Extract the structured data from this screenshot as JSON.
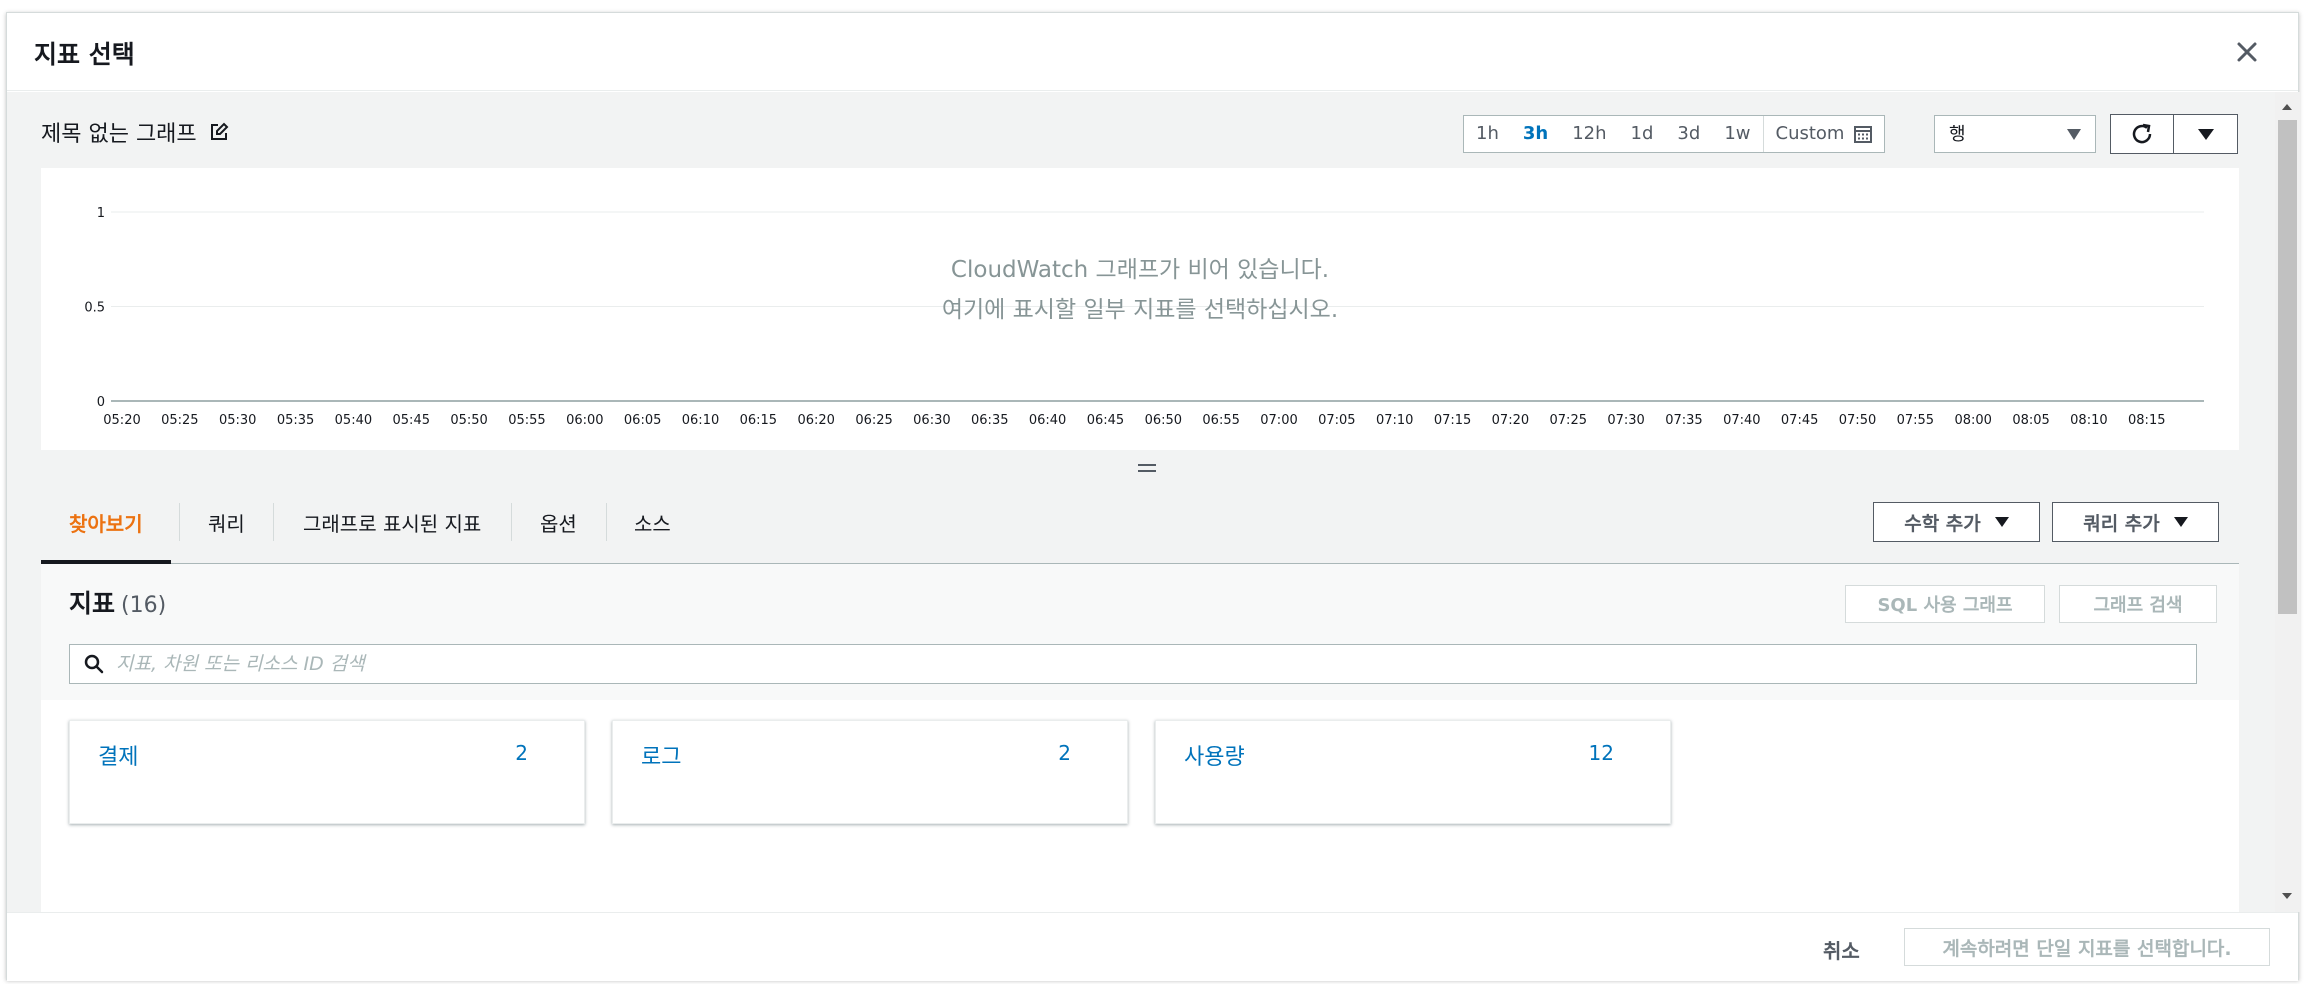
{
  "modal": {
    "title": "지표 선택",
    "close_icon": "close-icon"
  },
  "graph": {
    "title": "제목 없는 그래프",
    "edit_icon": "edit-icon",
    "time_ranges": [
      "1h",
      "3h",
      "12h",
      "1d",
      "3d",
      "1w"
    ],
    "active_range": "3h",
    "custom_label": "Custom",
    "custom_icon": "calendar-icon",
    "view_select_value": "행",
    "refresh_icon": "refresh-icon",
    "empty_line1": "CloudWatch 그래프가 비어 있습니다.",
    "empty_line2": "여기에 표시할 일부 지표를 선택하십시오."
  },
  "chart_data": {
    "type": "line",
    "x": [
      "05:20",
      "05:25",
      "05:30",
      "05:35",
      "05:40",
      "05:45",
      "05:50",
      "05:55",
      "06:00",
      "06:05",
      "06:10",
      "06:15",
      "06:20",
      "06:25",
      "06:30",
      "06:35",
      "06:40",
      "06:45",
      "06:50",
      "06:55",
      "07:00",
      "07:05",
      "07:10",
      "07:15",
      "07:20",
      "07:25",
      "07:30",
      "07:35",
      "07:40",
      "07:45",
      "07:50",
      "07:55",
      "08:00",
      "08:05",
      "08:10",
      "08:15"
    ],
    "y_ticks": [
      "1",
      "0.5",
      "0"
    ],
    "ylim": [
      0,
      1
    ],
    "series": [],
    "grid": true
  },
  "tabs": [
    {
      "label": "찾아보기",
      "active": true
    },
    {
      "label": "쿼리",
      "active": false
    },
    {
      "label": "그래프로 표시된 지표",
      "active": false
    },
    {
      "label": "옵션",
      "active": false
    },
    {
      "label": "소스",
      "active": false
    }
  ],
  "actions": {
    "add_math": "수학 추가",
    "add_query": "쿼리 추가"
  },
  "metrics": {
    "title": "지표",
    "count": "(16)",
    "sql_graph": "SQL 사용 그래프",
    "graph_search": "그래프 검색",
    "search_placeholder": "지표, 차원 또는 리소스 ID 검색",
    "search_icon": "search-icon",
    "namespaces": [
      {
        "name": "결제",
        "count": "2"
      },
      {
        "name": "로그",
        "count": "2"
      },
      {
        "name": "사용량",
        "count": "12"
      }
    ]
  },
  "footer": {
    "cancel": "취소",
    "primary": "계속하려면 단일 지표를 선택합니다."
  },
  "colors": {
    "accent_orange": "#ec7211",
    "link_blue": "#0073bb",
    "text_dark": "#16191f",
    "muted": "#879596"
  }
}
